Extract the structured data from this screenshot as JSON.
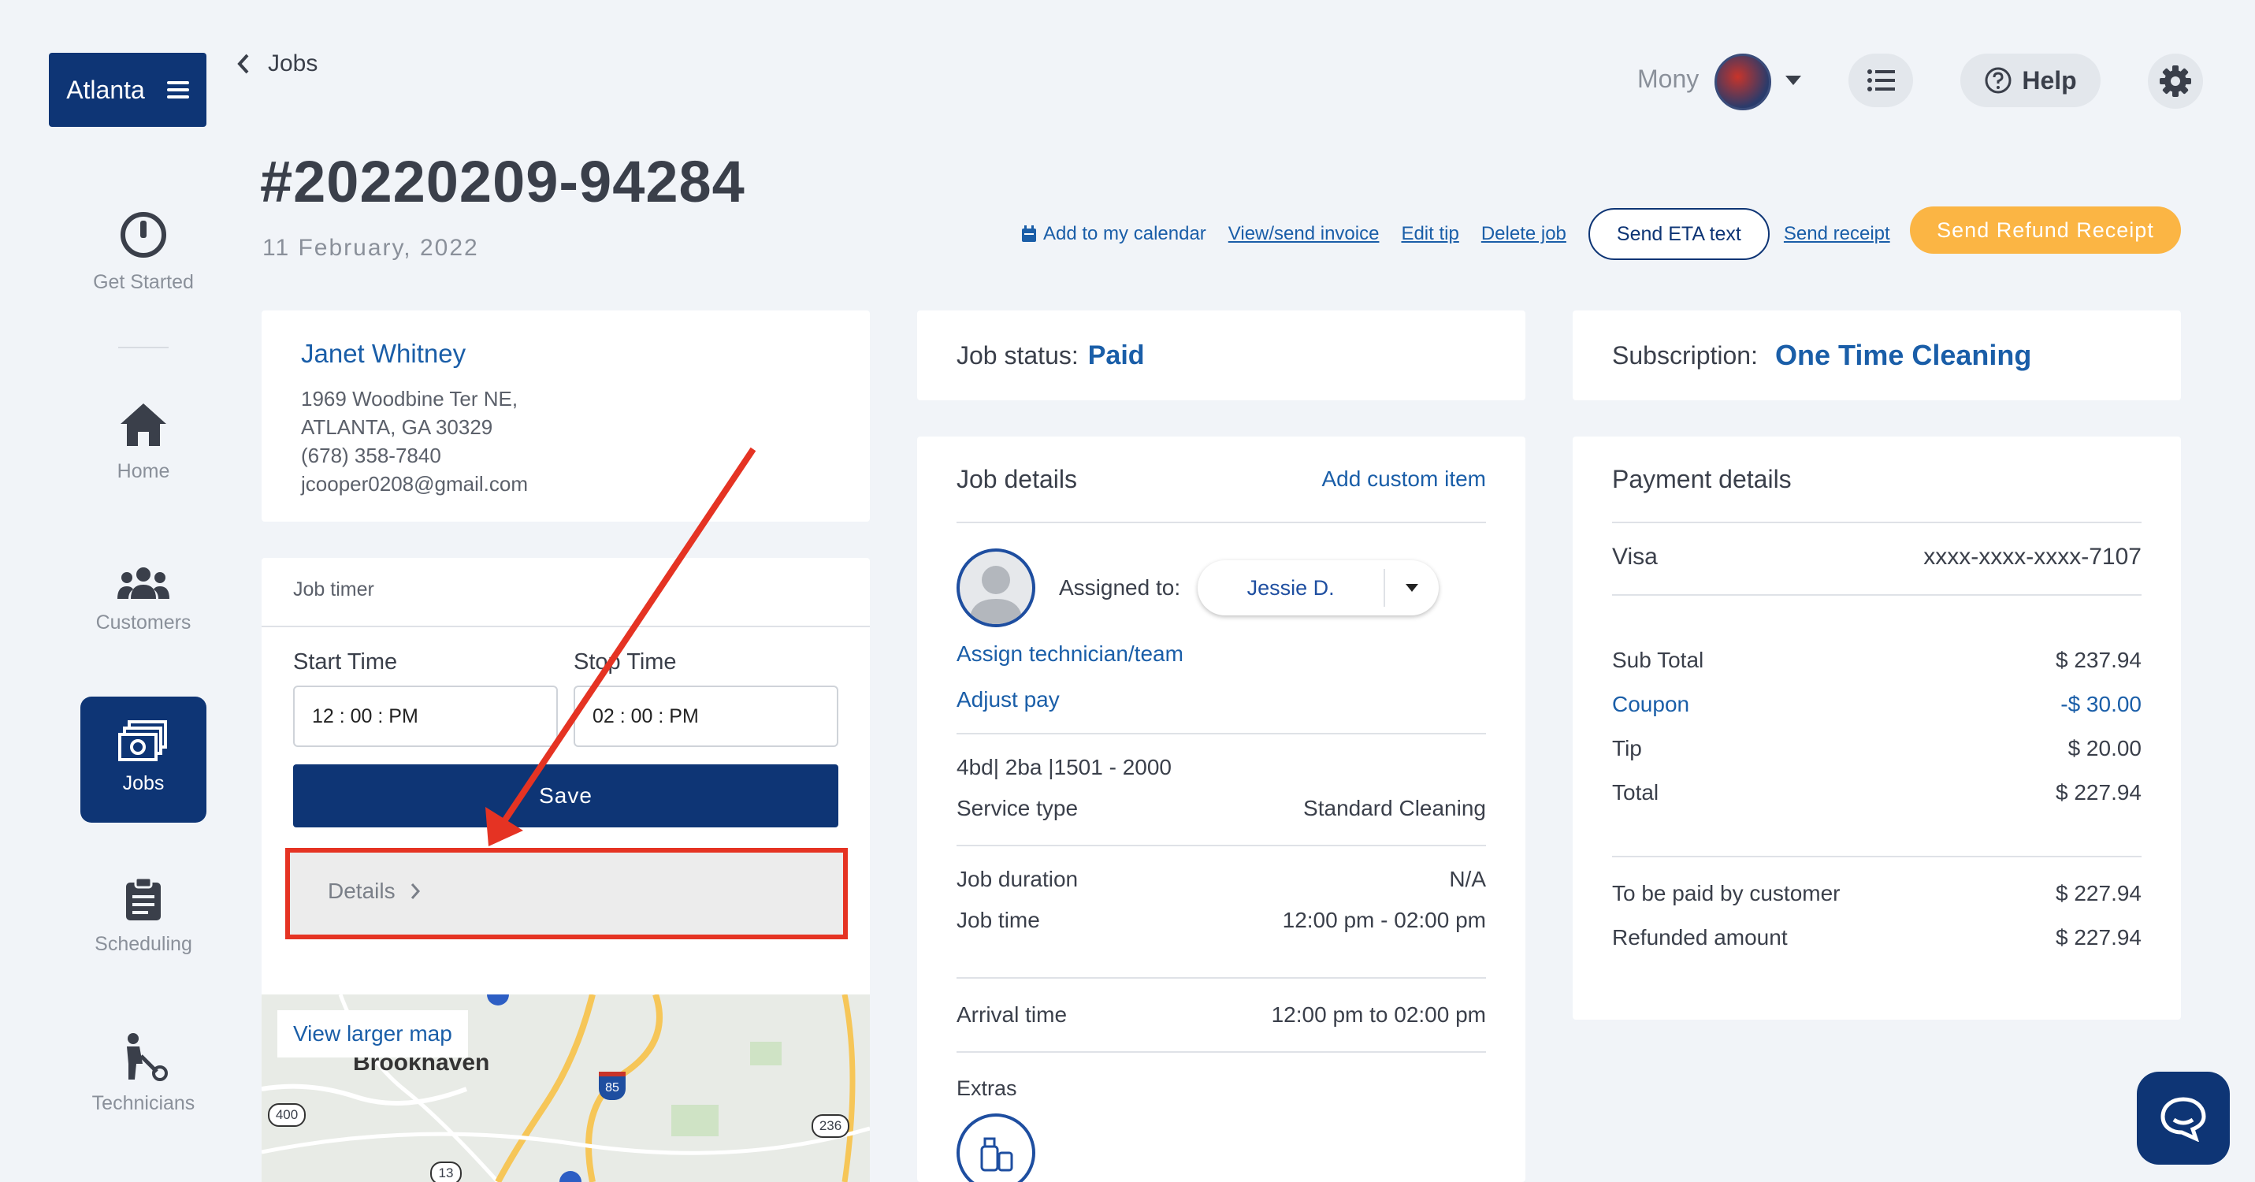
{
  "brand": {
    "city": "Atlanta"
  },
  "sidebar": {
    "items": [
      {
        "label": "Get Started"
      },
      {
        "label": "Home"
      },
      {
        "label": "Customers"
      },
      {
        "label": "Jobs"
      },
      {
        "label": "Scheduling"
      },
      {
        "label": "Technicians"
      }
    ]
  },
  "header": {
    "back_label": "Jobs",
    "job_id": "#20220209-94284",
    "job_date": "11 February, 2022",
    "user_name": "Mony",
    "help_label": "Help"
  },
  "actions": {
    "add_calendar": "Add to my calendar",
    "view_invoice": "View/send invoice",
    "edit_tip": "Edit tip",
    "delete_job": "Delete job",
    "send_eta": "Send ETA text",
    "send_receipt": "Send receipt",
    "send_refund": "Send Refund Receipt"
  },
  "customer": {
    "name": "Janet Whitney",
    "address1": "1969 Woodbine Ter NE,",
    "address2": "ATLANTA, GA 30329",
    "phone": "(678) 358-7840",
    "email": "jcooper0208@gmail.com"
  },
  "timer": {
    "title": "Job timer",
    "start_label": "Start Time",
    "stop_label": "Stop Time",
    "start_value": "12 : 00 : PM",
    "stop_value": "02 : 00 : PM",
    "save_label": "Save",
    "details_label": "Details"
  },
  "map": {
    "view_larger": "View larger map",
    "place": "Brookhaven",
    "shields": [
      "400",
      "85",
      "236",
      "13"
    ]
  },
  "status": {
    "label": "Job status:",
    "value": "Paid"
  },
  "subscription": {
    "label": "Subscription:",
    "value": "One Time Cleaning"
  },
  "job_details": {
    "title": "Job details",
    "add_custom": "Add custom item",
    "assigned_label": "Assigned to:",
    "assigned_value": "Jessie D.",
    "assign_link": "Assign technician/team",
    "adjust_pay": "Adjust pay",
    "rooms": "4bd| 2ba |1501 - 2000",
    "service_type_label": "Service type",
    "service_type_value": "Standard Cleaning",
    "duration_label": "Job duration",
    "duration_value": "N/A",
    "time_label": "Job time",
    "time_value": "12:00 pm - 02:00 pm",
    "arrival_label": "Arrival time",
    "arrival_value": "12:00 pm to 02:00 pm",
    "extras_label": "Extras"
  },
  "payment": {
    "title": "Payment details",
    "card_type": "Visa",
    "card_number": "xxxx-xxxx-xxxx-7107",
    "subtotal_label": "Sub Total",
    "subtotal_value": "$ 237.94",
    "coupon_label": "Coupon",
    "coupon_value": "-$ 30.00",
    "tip_label": "Tip",
    "tip_value": "$ 20.00",
    "total_label": "Total",
    "total_value": "$ 227.94",
    "to_be_paid_label": "To be paid by customer",
    "to_be_paid_value": "$ 227.94",
    "refunded_label": "Refunded amount",
    "refunded_value": "$ 227.94"
  },
  "colors": {
    "navy": "#0e3575",
    "link": "#1a5ea8",
    "orange": "#fbb544",
    "annotation": "#e53323"
  }
}
